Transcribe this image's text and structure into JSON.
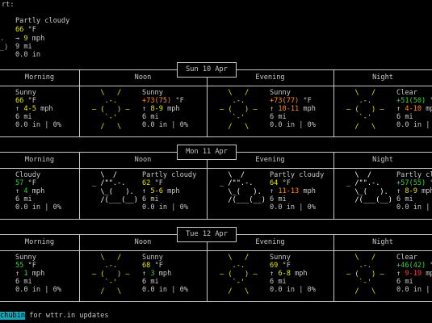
{
  "current": {
    "label": "rt:",
    "desc": "Partly cloudy",
    "temp": "66",
    "temp_unit": " °F",
    "wind_arrow": "→",
    "wind_speed": "9",
    "wind_unit": " mph",
    "visibility": "9 mi",
    "precip": "0.0 in",
    "art": [
      ".",
      "_)"
    ]
  },
  "periods": [
    "Morning",
    "Noon",
    "Evening",
    "Night"
  ],
  "days": [
    {
      "date": "Sun 10 Apr",
      "slots": [
        {
          "desc": "Sunny",
          "temp": "66",
          "temp_unit": " °F",
          "wind_arrow": "↑",
          "wind": "4-5",
          "wind_unit": " mph",
          "vis": "6 mi",
          "precip": "0.0 in | 0%"
        },
        {
          "desc": "Sunny",
          "temp": "+73(75)",
          "temp_unit": " °F",
          "wind_arrow": "↑",
          "wind": "8-9",
          "wind_unit": " mph",
          "vis": "6 mi",
          "precip": "0.0 in | 0%"
        },
        {
          "desc": "Sunny",
          "temp": "+73(77)",
          "temp_unit": " °F",
          "wind_arrow": "↑",
          "wind": "10-11",
          "wind_unit": " mph",
          "vis": "6 mi",
          "precip": "0.0 in | 0%"
        },
        {
          "desc": "Clear",
          "temp": "+51(50)",
          "temp_unit": " °F",
          "wind_arrow": "↑",
          "wind": "4-10",
          "wind_unit": " mph",
          "vis": "6 mi",
          "precip": "0.0 in | 0%"
        }
      ]
    },
    {
      "date": "Mon 11 Apr",
      "slots": [
        {
          "desc": "Cloudy",
          "temp": "57",
          "temp_unit": " °F",
          "wind_arrow": "↑",
          "wind": "4",
          "wind_unit": " mph",
          "vis": "6 mi",
          "precip": "0.0 in | 0%"
        },
        {
          "desc": "Partly cloudy",
          "temp": "62",
          "temp_unit": " °F",
          "wind_arrow": "↑",
          "wind": "5-6",
          "wind_unit": " mph",
          "vis": "6 mi",
          "precip": "0.0 in | 0%"
        },
        {
          "desc": "Partly cloudy",
          "temp": "64",
          "temp_unit": " °F",
          "wind_arrow": "↑",
          "wind": "11-13",
          "wind_unit": " mph",
          "vis": "6 mi",
          "precip": "0.0 in | 0%"
        },
        {
          "desc": "Partly cl",
          "temp": "+57(55)",
          "temp_unit": " °F",
          "wind_arrow": "↑",
          "wind": "8-9",
          "wind_unit": " mph",
          "vis": "6 mi",
          "precip": "0.0 in | 0%"
        }
      ]
    },
    {
      "date": "Tue 12 Apr",
      "slots": [
        {
          "desc": "Sunny",
          "temp": "55",
          "temp_unit": " °F",
          "wind_arrow": "↑",
          "wind": "1",
          "wind_unit": " mph",
          "vis": "6 mi",
          "precip": "0.0 in | 0%"
        },
        {
          "desc": "Sunny",
          "temp": "68",
          "temp_unit": " °F",
          "wind_arrow": "↑",
          "wind": "3",
          "wind_unit": " mph",
          "vis": "6 mi",
          "precip": "0.0 in | 0%"
        },
        {
          "desc": "Sunny",
          "temp": "69",
          "temp_unit": " °F",
          "wind_arrow": "↑",
          "wind": "6-8",
          "wind_unit": " mph",
          "vis": "6 mi",
          "precip": "0.0 in | 0%"
        },
        {
          "desc": "Clear",
          "temp": "+46(42)",
          "temp_unit": " °F",
          "wind_arrow": "↑",
          "wind": "9-19",
          "wind_unit": " mph",
          "vis": "6 mi",
          "precip": "0.0 in | 0%"
        }
      ]
    }
  ],
  "icons": {
    "sunny": [
      "  \\   /  ",
      "   .-.   ",
      "― (   ) ―",
      "   `-'   ",
      "  /   \\  "
    ],
    "clear": [
      "  \\   /  ",
      "   .-.   ",
      "― (   ) ―",
      "   `-'   ",
      "  /   \\  "
    ],
    "cloudy": [
      "",
      "     .--. ",
      "  .-(    ).",
      " (___.__)__)",
      ""
    ],
    "partly": [
      "  \\  /     ",
      "_ /\"\".-.   ",
      "  \\_(   ). ",
      "  /(___(__)",
      ""
    ]
  },
  "footer": {
    "handle": "chubin",
    "text": " for wttr.in updates"
  }
}
